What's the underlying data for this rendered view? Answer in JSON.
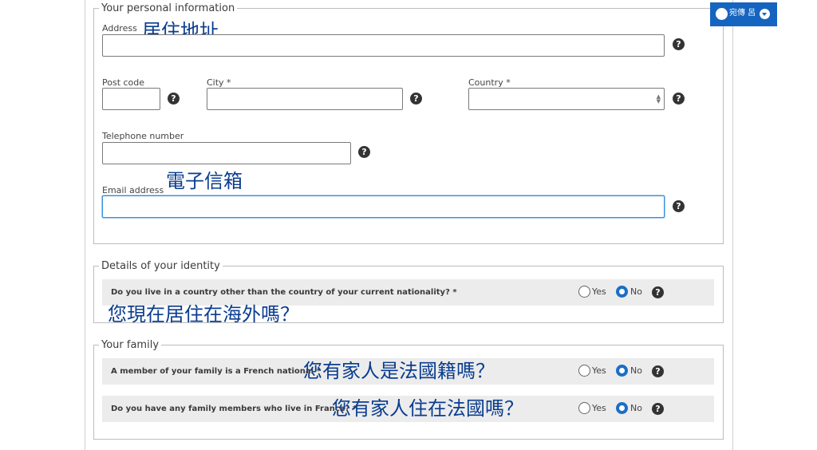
{
  "language_widget": {
    "label": "宛傳 呂"
  },
  "personal_info": {
    "legend": "Your personal information",
    "address": {
      "label": "Address",
      "annotation": "居住地址",
      "value": ""
    },
    "post_code": {
      "label": "Post code",
      "value": ""
    },
    "city": {
      "label": "City *",
      "value": ""
    },
    "country": {
      "label": "Country *",
      "selected": ""
    },
    "telephone": {
      "label": "Telephone number",
      "value": ""
    },
    "email": {
      "label": "Email address",
      "annotation": "電子信箱",
      "value": ""
    }
  },
  "identity": {
    "legend": "Details of your identity",
    "question": "Do you live in a country other than the country of your current nationality? *",
    "annotation": "您現在居住在海外嗎？",
    "yes_label": "Yes",
    "no_label": "No",
    "selected": "No"
  },
  "family": {
    "legend": "Your family",
    "questions": [
      {
        "text": "A member of your family is a French national *",
        "annotation": "您有家人是法國籍嗎？",
        "yes_label": "Yes",
        "no_label": "No",
        "selected": "No"
      },
      {
        "text": "Do you have any family members who live in France? *",
        "annotation": "您有家人住在法國嗎？",
        "yes_label": "Yes",
        "no_label": "No",
        "selected": "No"
      }
    ]
  },
  "help_icon_glyph": "?",
  "colors": {
    "accent": "#1565c0",
    "annotation": "#0a3d8f",
    "radio_checked": "#1a6fc4"
  }
}
